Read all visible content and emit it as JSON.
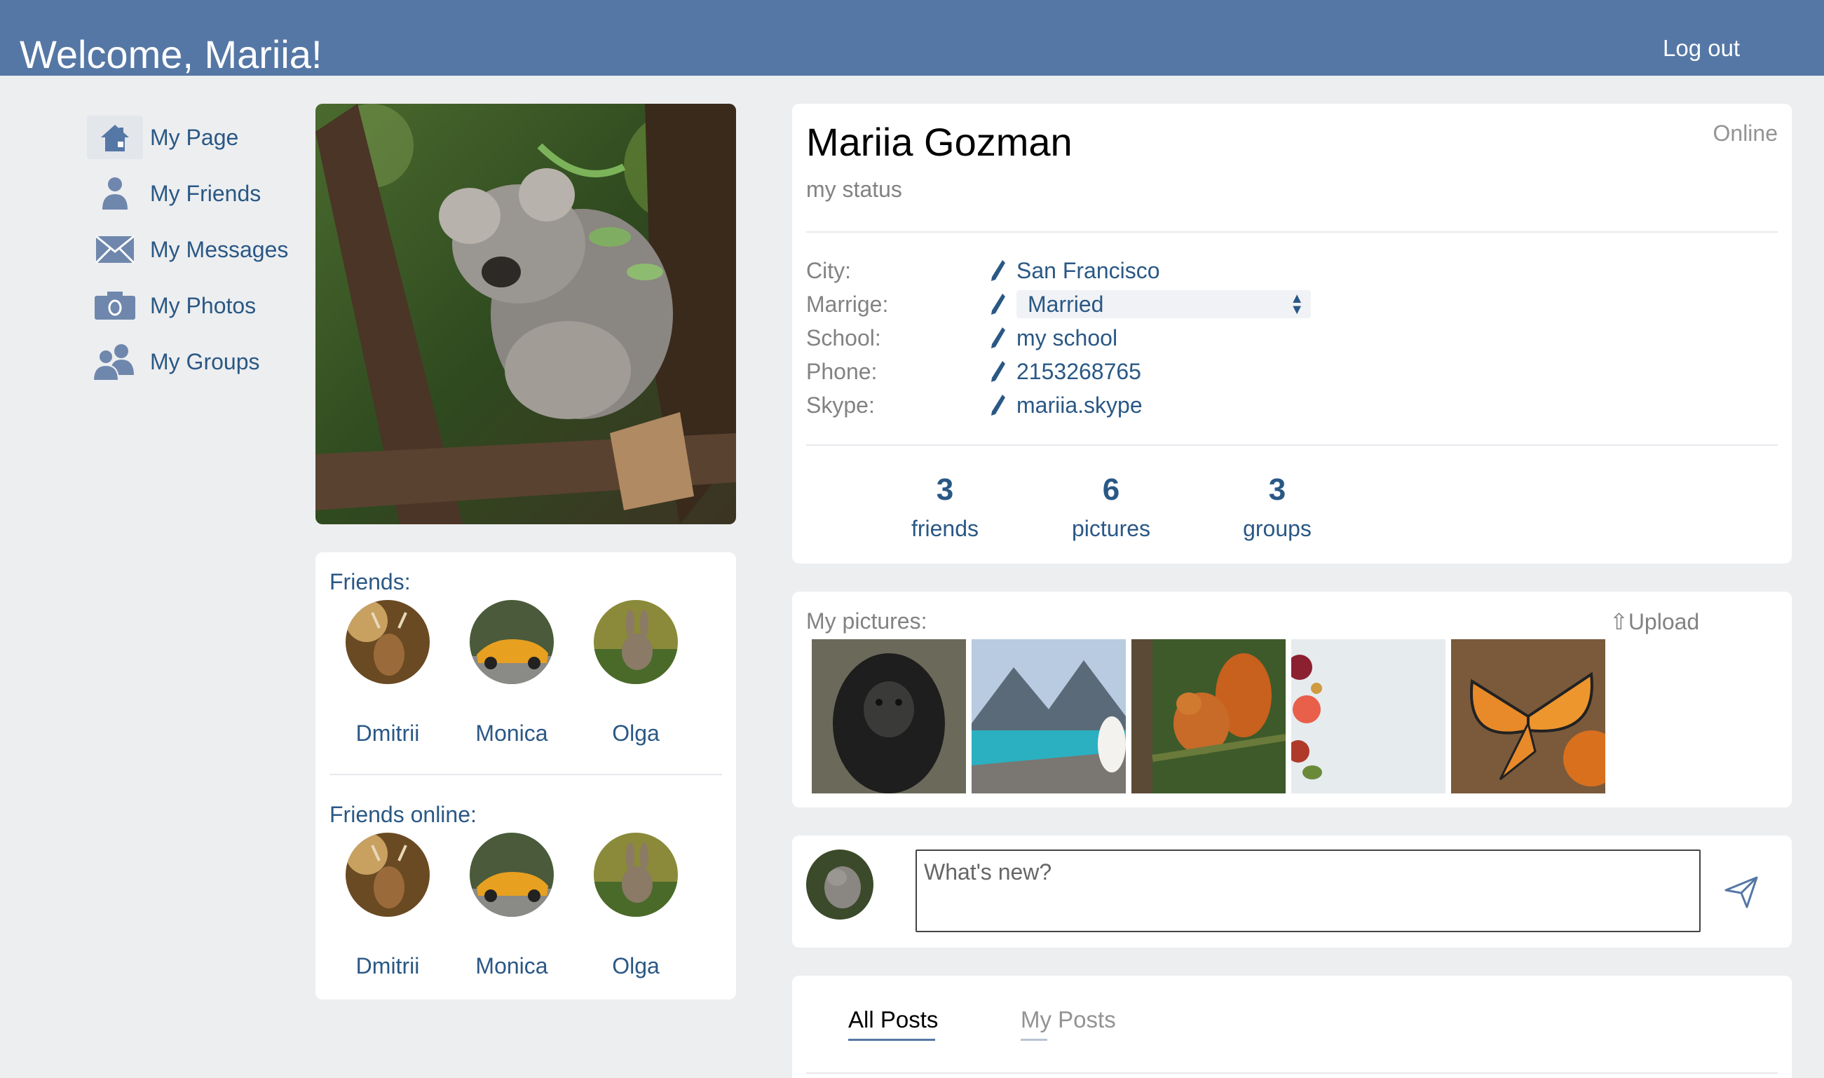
{
  "header": {
    "welcome": "Welcome, Mariia!",
    "logout_label": "Log out"
  },
  "sidebar": {
    "items": [
      {
        "label": "My Page",
        "icon": "home-icon",
        "active": true
      },
      {
        "label": "My Friends",
        "icon": "person-icon"
      },
      {
        "label": "My Messages",
        "icon": "envelope-icon"
      },
      {
        "label": "My Photos",
        "icon": "camera-icon"
      },
      {
        "label": "My Groups",
        "icon": "group-icon"
      }
    ]
  },
  "friends": {
    "title": "Friends:",
    "list": [
      "Dmitrii",
      "Monica",
      "Olga"
    ],
    "online_title": "Friends online:",
    "online_list": [
      "Dmitrii",
      "Monica",
      "Olga"
    ]
  },
  "profile": {
    "name": "Mariia Gozman",
    "presence": "Online",
    "status": "my status",
    "info": {
      "city_label": "City:",
      "city": "San Francisco",
      "marriage_label": "Marrige:",
      "marriage": "Married",
      "school_label": "School:",
      "school": "my school",
      "phone_label": "Phone:",
      "phone": "2153268765",
      "skype_label": "Skype:",
      "skype": "mariia.skype"
    },
    "stats": [
      {
        "num": "3",
        "label": "friends"
      },
      {
        "num": "6",
        "label": "pictures"
      },
      {
        "num": "3",
        "label": "groups"
      }
    ]
  },
  "pictures": {
    "title": "My pictures:",
    "upload_label": "Upload",
    "items": [
      "gorilla",
      "mountain-lake",
      "squirrel",
      "food-flatlay",
      "butterfly"
    ]
  },
  "post": {
    "placeholder": "What's new?"
  },
  "tabs": {
    "all_posts": "All Posts",
    "my_posts": "My Posts"
  },
  "colors": {
    "header": "#5577a5",
    "link": "#2a5885",
    "background": "#edeef0"
  }
}
